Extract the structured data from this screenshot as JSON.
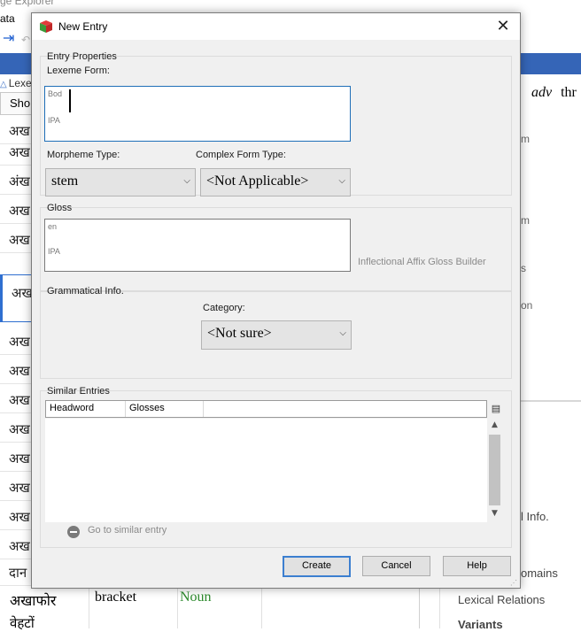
{
  "background": {
    "window_title": "ge Explorer",
    "menu_text": "ata",
    "tab_label": "Lexe",
    "column_header": "Sho",
    "rows": [
      "अख",
      "अख",
      "अंख",
      "अख",
      "अख",
      "अख",
      "अख",
      "अख",
      "अख",
      "अख",
      "अख",
      "अख",
      "अख",
      "अख",
      "दान"
    ],
    "row_full": {
      "word": "अखाफोर",
      "gloss": "bracket",
      "pos": "Noun"
    },
    "row_partial": "वेहटों",
    "right_header_pos": "adv",
    "right_header_word": "thr",
    "right_items": [
      "m",
      "m",
      "s",
      "on"
    ],
    "right_labels": [
      "l Info.",
      "omains",
      "Lexical Relations",
      "Variants"
    ]
  },
  "dialog": {
    "title": "New Entry",
    "close_glyph": "✕",
    "entry_properties": {
      "group_label": "Entry Properties",
      "lexeme_form_label": "Lexeme Form:",
      "ws_vernacular": "Bod",
      "ws_ipa": "IPA",
      "morpheme_type_label": "Morpheme Type:",
      "morpheme_type_value": "stem",
      "complex_form_type_label": "Complex Form Type:",
      "complex_form_type_value": "<Not Applicable>"
    },
    "gloss": {
      "group_label": "Gloss",
      "ws_en": "en",
      "ws_ipa": "IPA",
      "builder_link": "Inflectional Affix Gloss Builder"
    },
    "grammatical_info": {
      "group_label": "Grammatical Info.",
      "category_label": "Category:",
      "category_value": "<Not sure>"
    },
    "similar_entries": {
      "group_label": "Similar Entries",
      "columns": [
        "Headword",
        "Glosses"
      ],
      "go_link": "Go to similar entry"
    },
    "buttons": {
      "create": "Create",
      "cancel": "Cancel",
      "help": "Help"
    }
  }
}
